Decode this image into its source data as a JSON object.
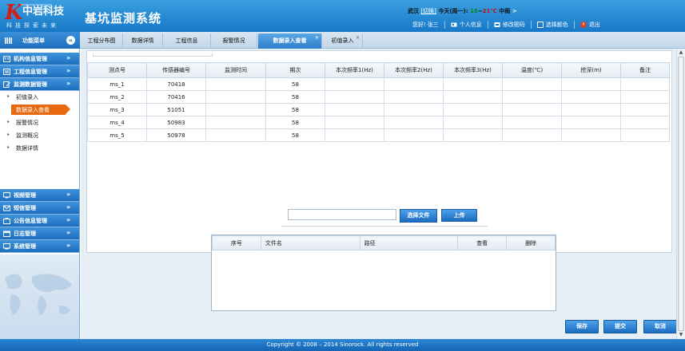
{
  "header": {
    "logo_name": "中岩科技",
    "logo_en": "ZHONGYAN TECHNOLOGY",
    "logo_slogan": "科技探索未来",
    "app_title": "基坑监测系统",
    "weather_city": "武汉",
    "weather_switch": "[切换]",
    "weather_day": "今天(周一):",
    "weather_temp_low": "15",
    "weather_tilde": "~",
    "weather_temp_high": "21℃",
    "weather_cond": "中雨",
    "weather_next": ">",
    "greeting": "您好!",
    "user_name": "张三",
    "personal_info": "个人信息",
    "change_password": "修改密码",
    "choose_color": "选择颜色",
    "logout": "退出"
  },
  "menu": {
    "title": "功能菜单",
    "collapse_symbol": "«"
  },
  "tabs": [
    {
      "label": "工程分布图"
    },
    {
      "label": "数据详情"
    },
    {
      "label": "工程信息"
    },
    {
      "label": "报警情况"
    },
    {
      "label": "数据录入查看",
      "active": true
    },
    {
      "label": "初值录入"
    }
  ],
  "sidebar": {
    "groups_top": [
      {
        "label": "机构信息管理"
      },
      {
        "label": "工程信息管理"
      },
      {
        "label": "监测数据管理"
      }
    ],
    "sub_items": [
      {
        "label": "初值录入"
      },
      {
        "label": "数据录入查看",
        "active": true
      },
      {
        "label": "报警情况"
      },
      {
        "label": "监测概况"
      },
      {
        "label": "数据详情"
      }
    ],
    "groups_bottom": [
      {
        "label": "视频管理"
      },
      {
        "label": "短信管理"
      },
      {
        "label": "公告信息管理"
      },
      {
        "label": "日志管理"
      },
      {
        "label": "系统管理"
      }
    ],
    "chevron": "»"
  },
  "data_table": {
    "columns": [
      "测点号",
      "传感器编号",
      "监测时间",
      "期次",
      "本次频率1(Hz)",
      "本次频率2(Hz)",
      "本次频率3(Hz)",
      "温度(℃)",
      "挖深(m)",
      "备注"
    ],
    "rows": [
      [
        "ms_1",
        "70418",
        "",
        "58",
        "",
        "",
        "",
        "",
        "",
        ""
      ],
      [
        "ms_2",
        "70416",
        "",
        "58",
        "",
        "",
        "",
        "",
        "",
        ""
      ],
      [
        "ms_3",
        "51051",
        "",
        "58",
        "",
        "",
        "",
        "",
        "",
        ""
      ],
      [
        "ms_4",
        "50983",
        "",
        "58",
        "",
        "",
        "",
        "",
        "",
        ""
      ],
      [
        "ms_5",
        "50978",
        "",
        "58",
        "",
        "",
        "",
        "",
        "",
        ""
      ]
    ]
  },
  "upload": {
    "file_value": "",
    "choose_file": "选择文件",
    "upload": "上传"
  },
  "files_table": {
    "columns": [
      "序号",
      "文件名",
      "路径",
      "查看",
      "删除"
    ]
  },
  "actions": {
    "save": "保存",
    "submit": "提交",
    "cancel": "取消"
  },
  "footer": {
    "copyright": "Copyright © 2008 – 2014 Sinorock. All rights reserved"
  },
  "colors": {
    "header_blue": "#1878c8",
    "active_orange": "#e86a10",
    "button_blue": "#1c6cc0"
  }
}
